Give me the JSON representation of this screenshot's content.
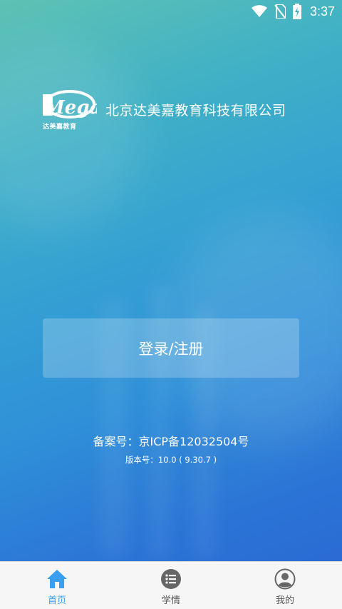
{
  "status_bar": {
    "time": "3:37",
    "icons": [
      "wifi-icon",
      "no-sim-icon",
      "battery-charging-icon"
    ]
  },
  "brand": {
    "logo_text": "Mega",
    "logo_tagline": "达美嘉教育",
    "company_name": "北京达美嘉教育科技有限公司"
  },
  "login": {
    "button_label": "登录/注册"
  },
  "footer_info": {
    "icp": "备案号：京ICP备12032504号",
    "version": "版本号：10.0 ( 9.30.7 )"
  },
  "tabbar": {
    "items": [
      {
        "label": "首页",
        "icon": "home-icon",
        "active": true
      },
      {
        "label": "学情",
        "icon": "list-icon",
        "active": false
      },
      {
        "label": "我的",
        "icon": "user-icon",
        "active": false
      }
    ]
  },
  "colors": {
    "accent": "#3a9ff0",
    "tabbar_bg": "#f6f6f6",
    "gradient_top": "#5ec2b4",
    "gradient_bottom": "#2a66d2"
  }
}
